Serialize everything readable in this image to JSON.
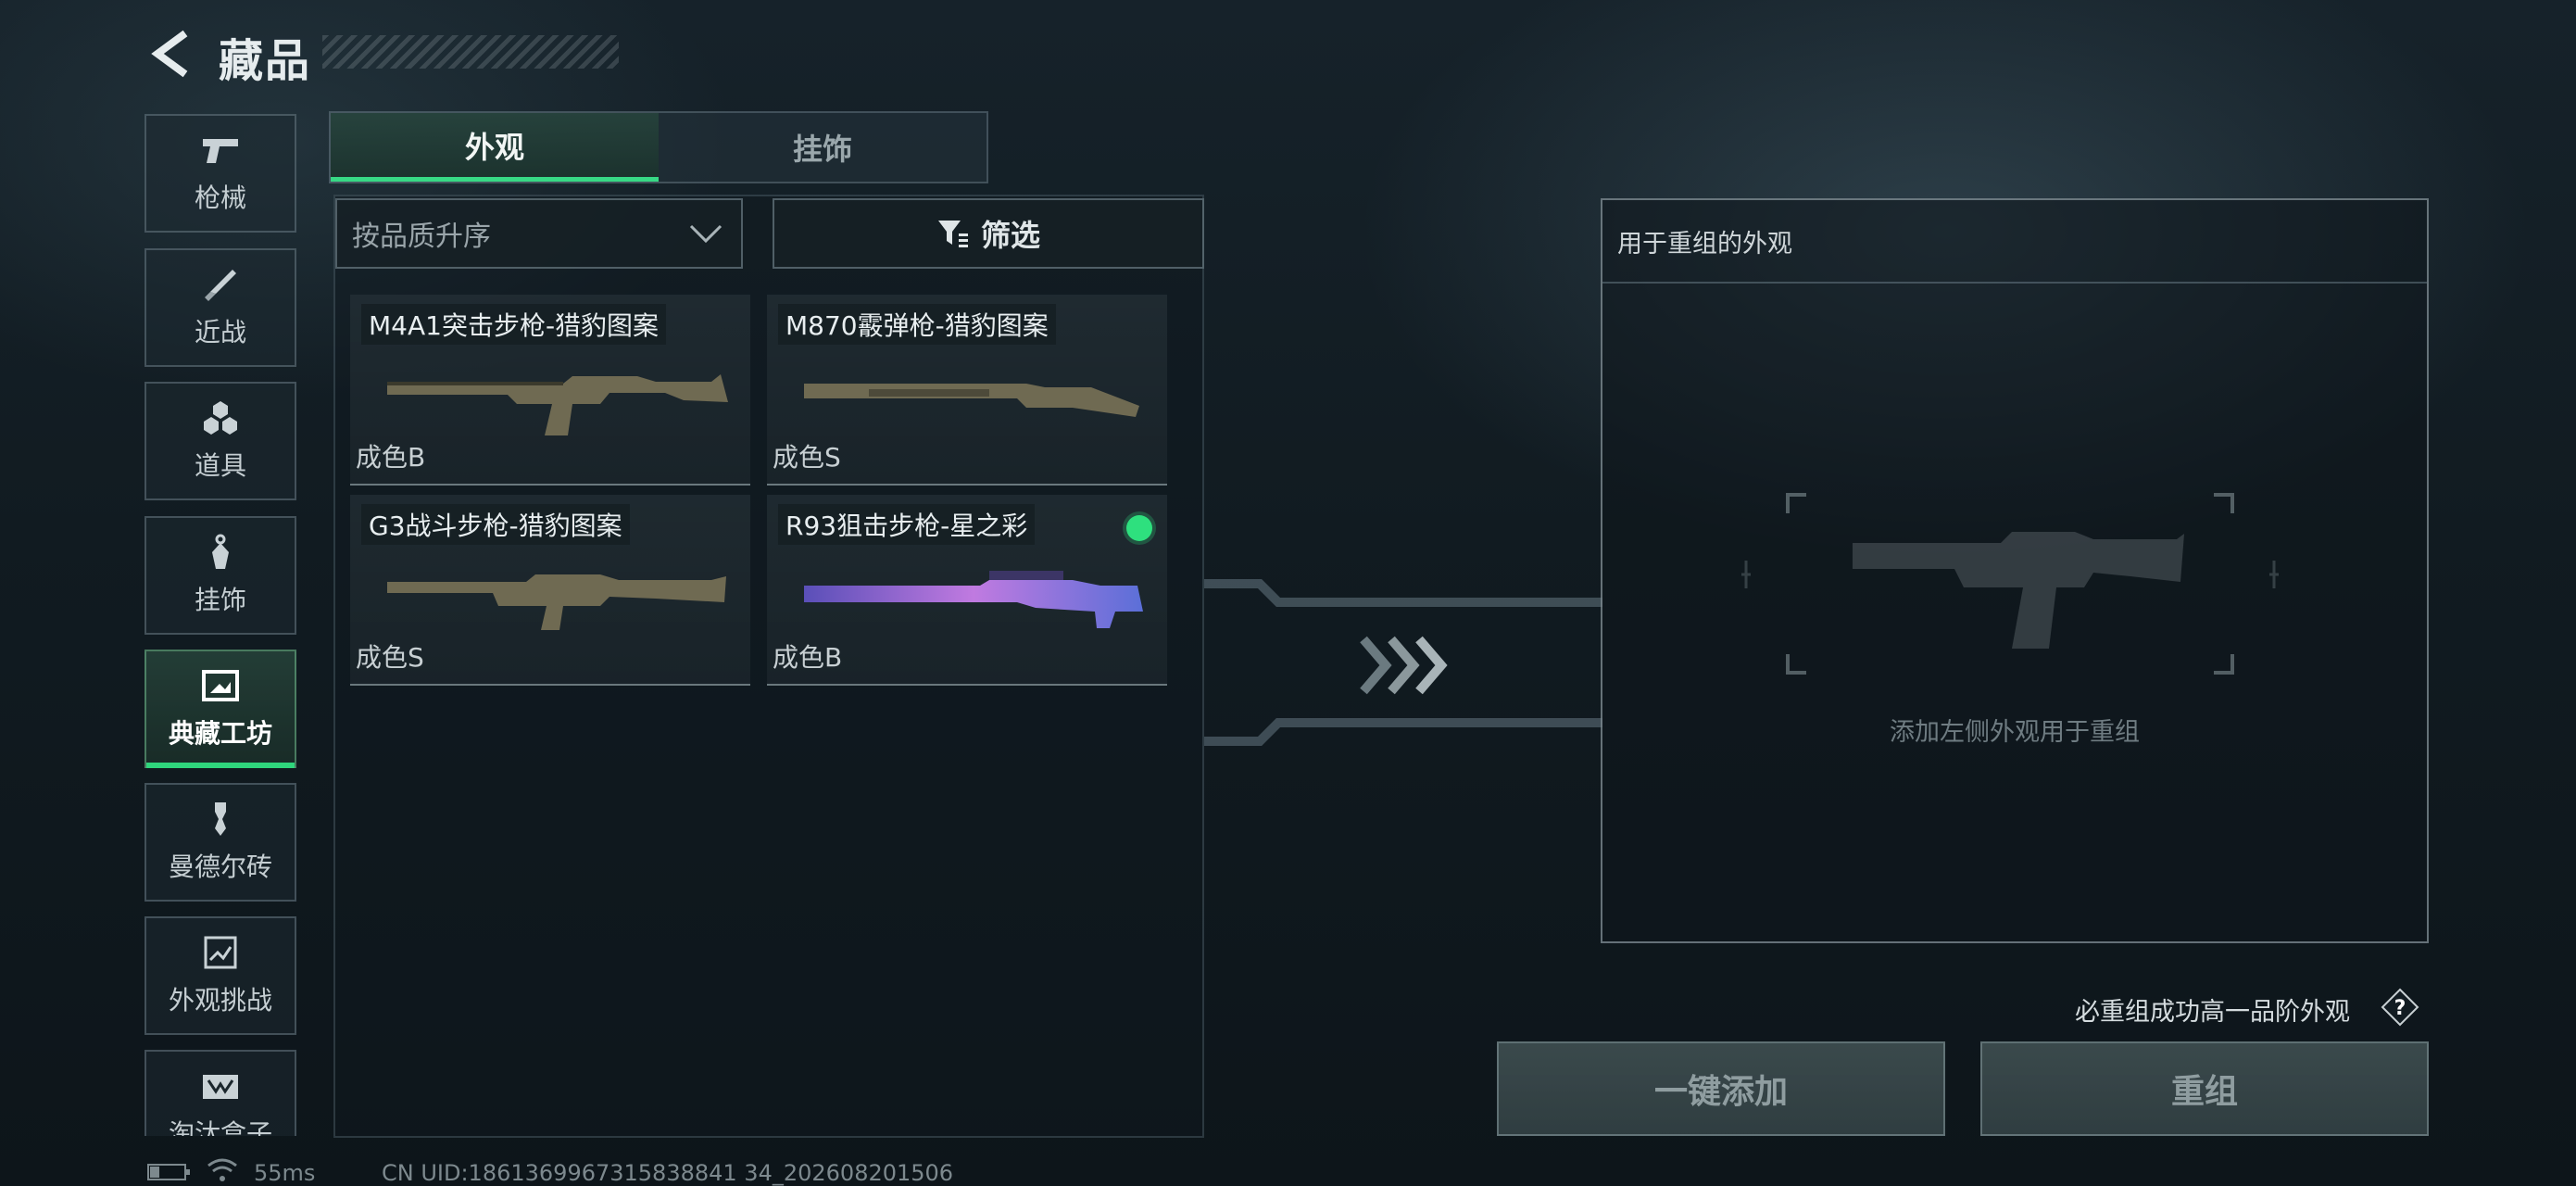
{
  "header": {
    "title": "藏品",
    "back_icon": "back-chevron-icon"
  },
  "sidebar": {
    "items": [
      {
        "label": "枪械",
        "icon": "pistol-icon",
        "active": false
      },
      {
        "label": "近战",
        "icon": "knife-icon",
        "active": false
      },
      {
        "label": "道具",
        "icon": "grenade-cluster-icon",
        "active": false
      },
      {
        "label": "挂饰",
        "icon": "charm-tag-icon",
        "active": false
      },
      {
        "label": "典藏工坊",
        "icon": "workshop-frame-icon",
        "active": true
      },
      {
        "label": "曼德尔砖",
        "icon": "brick-key-icon",
        "active": false
      },
      {
        "label": "外观挑战",
        "icon": "challenge-icon",
        "active": false
      },
      {
        "label": "淘汰盒子",
        "icon": "box-icon",
        "active": false
      }
    ]
  },
  "tabs": [
    {
      "label": "外观",
      "active": true
    },
    {
      "label": "挂饰",
      "active": false
    }
  ],
  "sort": {
    "label": "按品质升序"
  },
  "filter": {
    "label": "筛选"
  },
  "items": [
    {
      "name": "M4A1突击步枪-猎豹图案",
      "grade": "成色B",
      "selected": false
    },
    {
      "name": "M870霰弹枪-猎豹图案",
      "grade": "成色S",
      "selected": false
    },
    {
      "name": "G3战斗步枪-猎豹图案",
      "grade": "成色S",
      "selected": false
    },
    {
      "name": "R93狙击步枪-星之彩",
      "grade": "成色B",
      "selected": true
    }
  ],
  "remix_panel": {
    "title": "用于重组的外观",
    "hint": "添加左侧外观用于重组"
  },
  "note": "必重组成功高一品阶外观",
  "buttons": {
    "add_all": "一键添加",
    "remix": "重组"
  },
  "status_bar": {
    "ping": "55ms",
    "uid": "CN UID:1861369967315838841 34_202608201506"
  },
  "colors": {
    "accent_green": "#2fd67c",
    "panel_bg": "#111b21"
  }
}
